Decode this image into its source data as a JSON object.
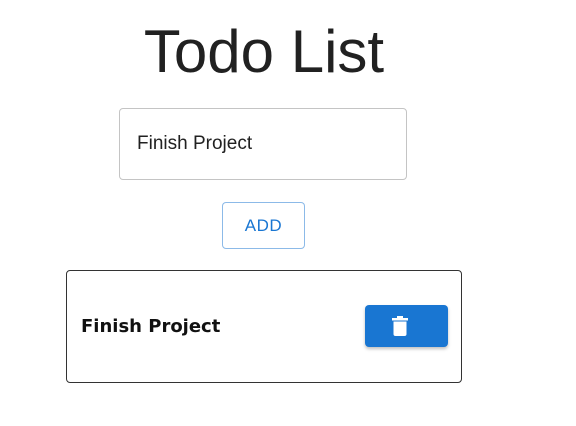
{
  "header": {
    "title": "Todo List"
  },
  "form": {
    "input_value": "Finish Project",
    "add_label": "ADD"
  },
  "todos": [
    {
      "text": "Finish Project",
      "delete_icon": "trash-icon"
    }
  ],
  "colors": {
    "primary": "#1976d2",
    "text": "#212121",
    "input_border": "#c4c4c4",
    "item_border": "#333333"
  }
}
